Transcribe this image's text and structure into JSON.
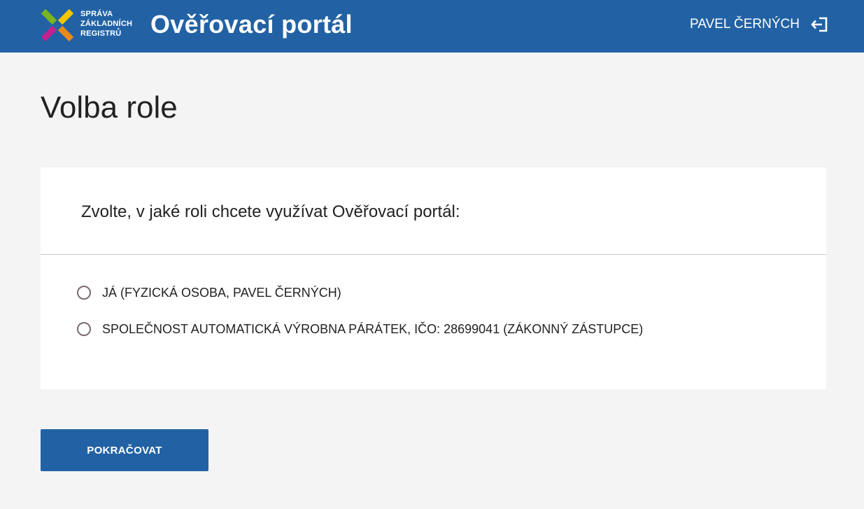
{
  "header": {
    "logo_lines": [
      "SPRÁVA",
      "ZÁKLADNÍCH",
      "REGISTRŮ"
    ],
    "app_title": "Ověřovací portál",
    "user_name": "PAVEL ČERNÝCH",
    "logout_icon": "logout-icon"
  },
  "page": {
    "title": "Volba role"
  },
  "role_card": {
    "question": "Zvolte, v jaké roli chcete využívat Ověřovací portál:",
    "options": [
      {
        "label": "JÁ (FYZICKÁ OSOBA, PAVEL ČERNÝCH)",
        "selected": false
      },
      {
        "label": "SPOLEČNOST AUTOMATICKÁ VÝROBNA PÁRÁTEK, IČO: 28699041 (ZÁKONNÝ ZÁSTUPCE)",
        "selected": false
      }
    ]
  },
  "actions": {
    "continue_label": "POKRAČOVAT"
  },
  "colors": {
    "header_bg": "#2262a4",
    "page_bg": "#f4f4f4",
    "button_bg": "#2262a4",
    "logo_green": "#7ab51d",
    "logo_yellow": "#f6c600",
    "logo_magenta": "#c2228f",
    "logo_orange": "#e88a1a"
  }
}
